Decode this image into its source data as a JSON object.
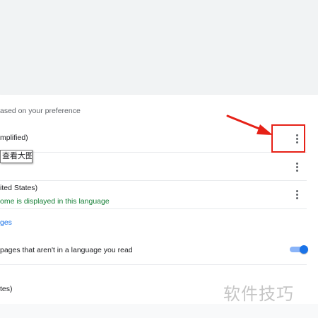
{
  "section": {
    "description": "ased on your preference"
  },
  "languages": [
    {
      "name": "mplified)"
    },
    {
      "name": "ited States)",
      "note": "ome is displayed in this language"
    }
  ],
  "tooltip": {
    "text": "查看大图"
  },
  "add_languages_link": "ges",
  "translate_offer": {
    "label": "pages that aren't in a language you read",
    "enabled": true
  },
  "spell_check": {
    "value": "tes)"
  },
  "watermark": "软件技巧",
  "colors": {
    "accent": "#1a73e8",
    "success_text": "#188038",
    "highlight_box": "#e62117"
  },
  "icons": [
    "more-vert-icon",
    "annotation-arrow"
  ]
}
